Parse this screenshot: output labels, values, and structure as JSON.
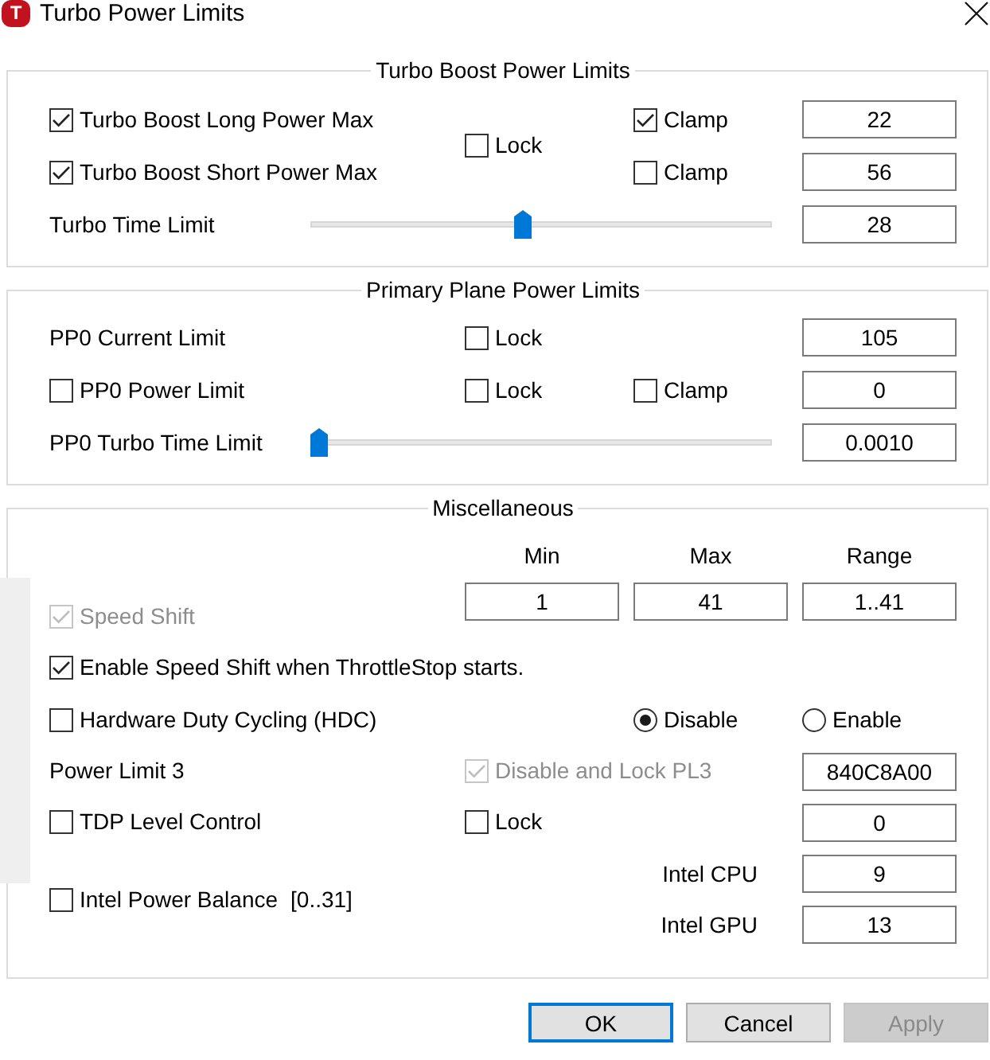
{
  "window": {
    "logo": "T",
    "title": "Turbo Power Limits"
  },
  "turbo_boost": {
    "title": "Turbo Boost Power Limits",
    "rows": [
      {
        "label": "Turbo Boost Long Power Max",
        "checked": true,
        "clamp": {
          "label": "Clamp",
          "checked": true
        },
        "value": "22"
      },
      {
        "label": "Turbo Boost Short Power Max",
        "checked": true,
        "clamp": {
          "label": "Clamp",
          "checked": false
        },
        "value": "56"
      }
    ],
    "lock": {
      "label": "Lock",
      "checked": false
    },
    "time_limit": {
      "label": "Turbo Time Limit",
      "level": 0.46,
      "value": "28"
    }
  },
  "primary_plane": {
    "title": "Primary Plane Power Limits",
    "rows": [
      {
        "kind": "label",
        "label": "PP0 Current Limit",
        "lock": {
          "label": "Lock",
          "checked": false
        },
        "value": "105"
      },
      {
        "kind": "checkbox",
        "label": "PP0 Power Limit",
        "checked": false,
        "lock": {
          "label": "Lock",
          "checked": false
        },
        "clamp": {
          "label": "Clamp",
          "checked": false
        },
        "value": "0"
      },
      {
        "kind": "slider",
        "label": "PP0 Turbo Time Limit",
        "level": 0,
        "value": "0.0010"
      }
    ]
  },
  "miscellaneous": {
    "title": "Miscellaneous",
    "columns": [
      "Min",
      "Max",
      "Range"
    ],
    "speed_shift": {
      "label": "Speed Shift",
      "checked": true,
      "disabled": true,
      "values": [
        "1",
        "41",
        "1..41"
      ]
    },
    "start_option": {
      "label": "Enable Speed Shift when ThrottleStop starts.",
      "checked": true
    },
    "hdc": {
      "label": "Hardware Duty Cycling (HDC)",
      "checked": false,
      "options": [
        {
          "label": "Disable",
          "selected": true
        },
        {
          "label": "Enable",
          "selected": false
        }
      ]
    },
    "power_limit_3": {
      "label": "Power Limit 3",
      "lock": {
        "label": "Disable and Lock PL3",
        "checked": true,
        "disabled": true
      },
      "value": "840C8A00"
    },
    "tdp_level": {
      "label": "TDP Level Control",
      "checked": false,
      "lock": {
        "label": "Lock",
        "checked": false
      },
      "value": "0"
    },
    "power_balance": {
      "label": "Intel Power Balance",
      "range": "[0..31]",
      "checked": false,
      "cpu": {
        "label": "Intel CPU",
        "value": "9"
      },
      "gpu": {
        "label": "Intel GPU",
        "value": "13"
      }
    }
  },
  "buttons": [
    {
      "label": "OK",
      "default": true,
      "disabled": false
    },
    {
      "label": "Cancel",
      "default": false,
      "disabled": false
    },
    {
      "label": "Apply",
      "default": false,
      "disabled": true
    }
  ]
}
